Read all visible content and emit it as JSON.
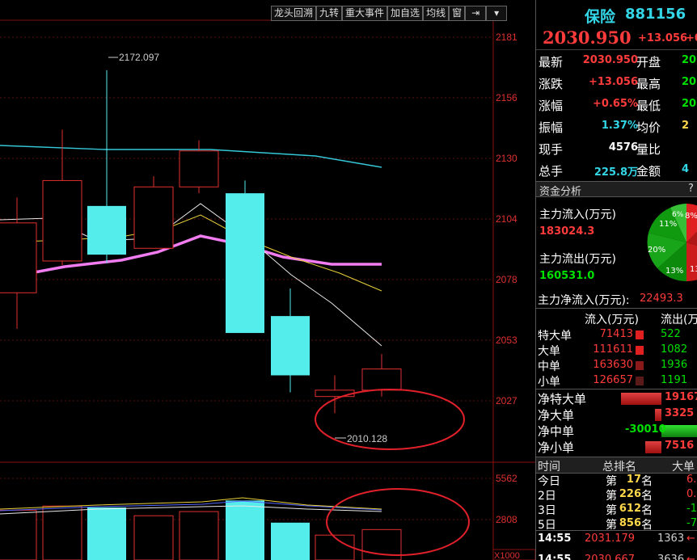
{
  "toolbar": {
    "items": [
      "龙头回溯",
      "九转",
      "重大事件",
      "加自选",
      "均线",
      "窗"
    ]
  },
  "price_axis": {
    "labels": [
      "2181",
      "2156",
      "2130",
      "2104",
      "2078",
      "2053",
      "2027"
    ]
  },
  "volume_axis": {
    "labels": [
      "5562",
      "2808"
    ],
    "unit": "X1000"
  },
  "chart_annotations": {
    "high": "2172.097",
    "low": "2010.128"
  },
  "chart_data": {
    "type": "candlestick",
    "ylim": [
      2003,
      2190
    ],
    "candles": [
      {
        "open": 2067,
        "close": 2100,
        "high": 2112,
        "low": 2050,
        "color": "red"
      },
      {
        "open": 2082,
        "close": 2120,
        "high": 2144,
        "low": 2080,
        "color": "red"
      },
      {
        "open": 2108,
        "close": 2085,
        "high": 2172.097,
        "low": 2081,
        "color": "cyan"
      },
      {
        "open": 2088,
        "close": 2117,
        "high": 2122,
        "low": 2088,
        "color": "red"
      },
      {
        "open": 2117,
        "close": 2134,
        "high": 2139,
        "low": 2114,
        "color": "red"
      },
      {
        "open": 2114,
        "close": 2048,
        "high": 2120,
        "low": 2048,
        "color": "cyan"
      },
      {
        "open": 2056,
        "close": 2028,
        "high": 2069,
        "low": 2020,
        "color": "cyan"
      },
      {
        "open": 2018,
        "close": 2021,
        "high": 2028,
        "low": 2010.128,
        "color": "red"
      },
      {
        "open": 2021,
        "close": 2031,
        "high": 2038,
        "low": 2018,
        "color": "red"
      }
    ],
    "volume_ylim": [
      0,
      5900
    ],
    "volumes": [
      {
        "v": 3600,
        "color": "red"
      },
      {
        "v": 3900,
        "color": "red"
      },
      {
        "v": 3800,
        "color": "cyan"
      },
      {
        "v": 3200,
        "color": "red"
      },
      {
        "v": 3500,
        "color": "red"
      },
      {
        "v": 4300,
        "color": "cyan"
      },
      {
        "v": 2700,
        "color": "cyan"
      },
      {
        "v": 1800,
        "color": "red"
      },
      {
        "v": 2200,
        "color": "red"
      }
    ]
  },
  "quote": {
    "name": "保险",
    "code": "881156",
    "price": "2030.950",
    "change": "+13.056",
    "change_cut": "+0",
    "rows": [
      {
        "l1": "最新",
        "v1": "2030.950",
        "c1": "red",
        "l2": "开盘",
        "v2": "20"
      },
      {
        "l1": "涨跌",
        "v1": "+13.056",
        "c1": "red",
        "l2": "最高",
        "v2": "20"
      },
      {
        "l1": "涨幅",
        "v1": "+0.65%",
        "c1": "red",
        "l2": "最低",
        "v2": "20"
      },
      {
        "l1": "振幅",
        "v1": "1.37%",
        "c1": "cyan",
        "l2": "均价",
        "v2": "2"
      },
      {
        "l1": "现手",
        "v1": "4576",
        "c1": "white",
        "l2": "量比",
        "v2": ""
      },
      {
        "l1": "总手",
        "v1": "225.8万",
        "c1": "cyan",
        "l2": "金额",
        "v2": "4"
      }
    ]
  },
  "fund": {
    "title": "资金分析",
    "inflow_label": "主力流入(万元)",
    "inflow": "183024.3",
    "outflow_label": "主力流出(万元)",
    "outflow": "160531.0",
    "net_label": "主力净流入(万元):",
    "net": "22493.3",
    "pie_labels": [
      "11%",
      "20%",
      "13%",
      "6%",
      "8%",
      "13"
    ]
  },
  "flow_table": {
    "headers": [
      "流入(万元)",
      "流出(万"
    ],
    "rows": [
      {
        "label": "特大单",
        "in": "71413",
        "out": "522"
      },
      {
        "label": "大单",
        "in": "111611",
        "out": "1082"
      },
      {
        "label": "中单",
        "in": "163630",
        "out": "1936"
      },
      {
        "label": "小单",
        "in": "126657",
        "out": "1191"
      }
    ]
  },
  "net_table": {
    "rows": [
      {
        "label": "净特大单",
        "value": "19167",
        "color": "red"
      },
      {
        "label": "净大单",
        "value": "3325",
        "color": "red"
      },
      {
        "label": "净中单",
        "value": "-30010",
        "color": "green"
      },
      {
        "label": "净小单",
        "value": "7516",
        "color": "red"
      }
    ]
  },
  "rank": {
    "headers": [
      "时间",
      "总排名",
      "大单"
    ],
    "rows": [
      {
        "period": "今日",
        "pre": "第",
        "rank": "17",
        "suf": "名",
        "v": "6."
      },
      {
        "period": "2日",
        "pre": "第",
        "rank": "226",
        "suf": "名",
        "v": "0."
      },
      {
        "period": "3日",
        "pre": "第",
        "rank": "612",
        "suf": "名",
        "v": "-1."
      },
      {
        "period": "5日",
        "pre": "第",
        "rank": "856",
        "suf": "名",
        "v": "-7."
      }
    ]
  },
  "ticks": [
    {
      "time": "14:55",
      "price": "2031.179",
      "vol": "1363"
    },
    {
      "time": "14:55",
      "price": "2030.667",
      "vol": "3636"
    }
  ]
}
